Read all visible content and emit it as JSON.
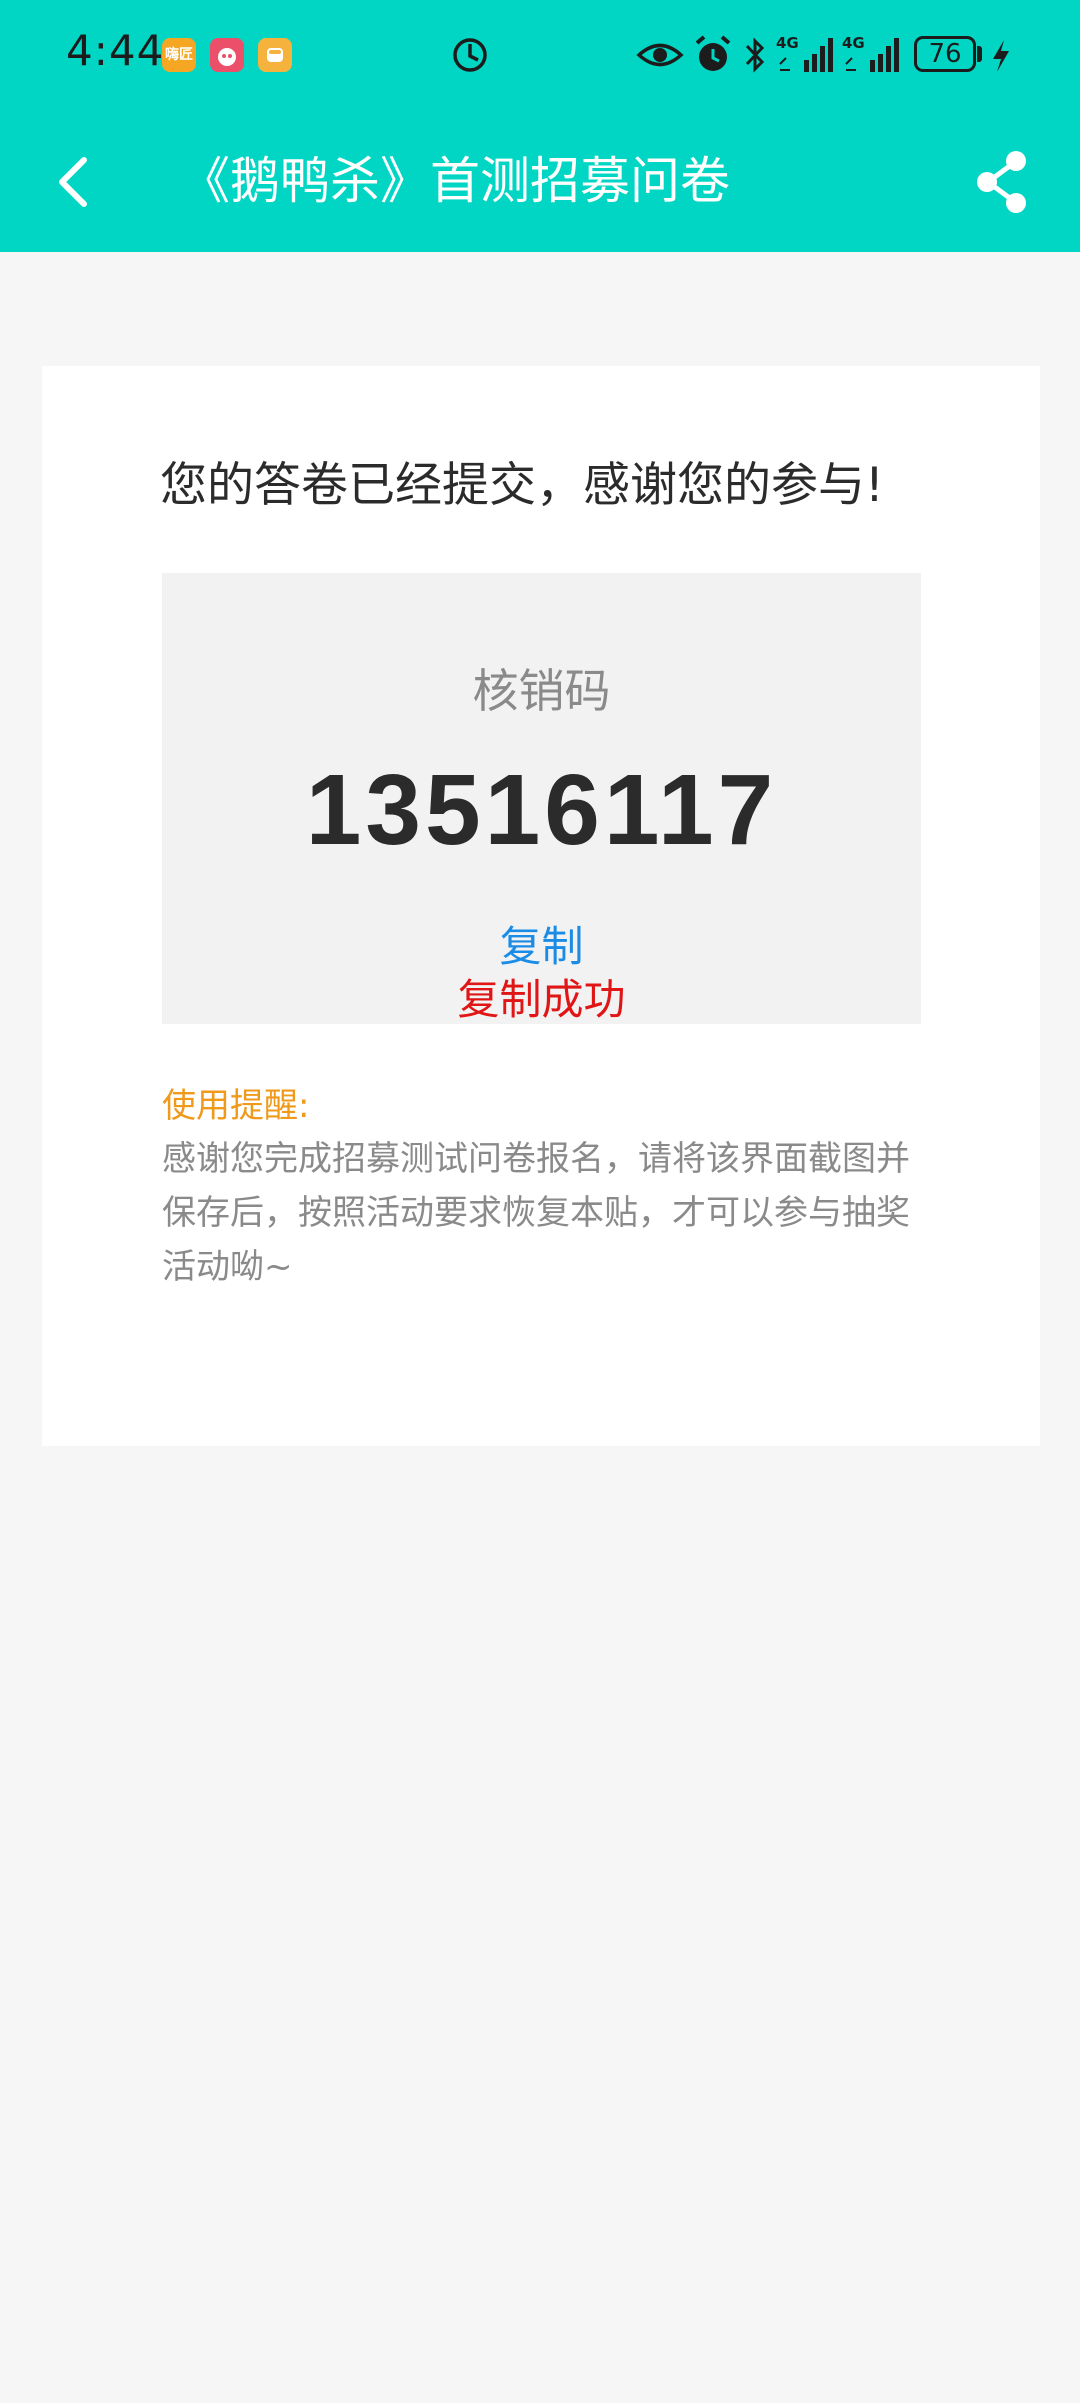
{
  "status_bar": {
    "time": "4:44",
    "notif_icons": [
      {
        "name": "app-notification-icon-1",
        "label": "嗨匠",
        "color": "#f5a623"
      },
      {
        "name": "app-notification-icon-2",
        "label": "",
        "color": "#ec4f6a"
      },
      {
        "name": "app-notification-icon-3",
        "label": "",
        "color": "#f5b33d"
      }
    ],
    "signal_1": "4G",
    "signal_2": "4G",
    "battery": "76"
  },
  "header": {
    "title": "《鹅鸭杀》首测招募问卷",
    "background": "#00d6c3"
  },
  "card": {
    "success_message": "您的答卷已经提交，感谢您的参与!",
    "code_label": "核销码",
    "code_value": "13516117",
    "copy_label": "复制",
    "copy_success": "复制成功",
    "tip_title": "使用提醒:",
    "tip_text": "感谢您完成招募测试问卷报名，请将该界面截图并保存后，按照活动要求恢复本贴，才可以参与抽奖活动呦~"
  },
  "colors": {
    "accent": "#00d6c3",
    "copy_link": "#1a8ce6",
    "copy_success": "#e01515",
    "tip_title": "#f09a1c"
  }
}
